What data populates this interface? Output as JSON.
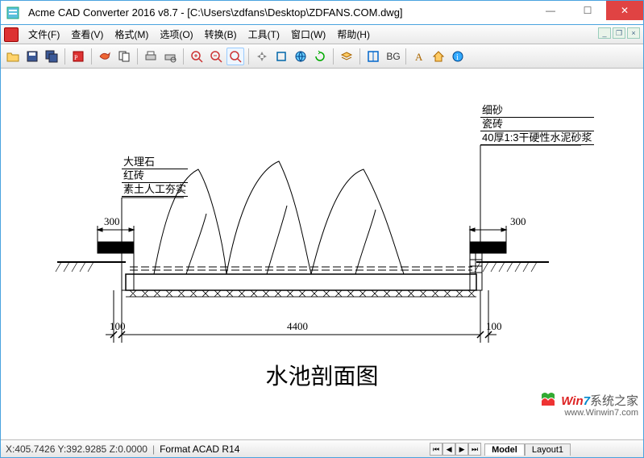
{
  "window": {
    "title": "Acme CAD Converter 2016 v8.7 - [C:\\Users\\zdfans\\Desktop\\ZDFANS.COM.dwg]"
  },
  "menus": {
    "file": "文件(F)",
    "view": "查看(V)",
    "format": "格式(M)",
    "options": "选项(O)",
    "convert": "转换(B)",
    "tools": "工具(T)",
    "window": "窗口(W)",
    "help": "帮助(H)"
  },
  "toolbar": {
    "bg_label": "BG"
  },
  "drawing": {
    "title": "水池剖面图",
    "left_labels": [
      "大理石",
      "红砖",
      "素土人工夯实"
    ],
    "right_labels": [
      "细砂",
      "瓷砖",
      "40厚1:3干硬性水泥砂浆"
    ],
    "dim_left_top": "300",
    "dim_right_top": "300",
    "dim_bottom_left": "100",
    "dim_bottom_center": "4400",
    "dim_bottom_right": "100"
  },
  "status": {
    "coords": "X:405.7426 Y:392.9285 Z:0.0000",
    "format": "Format ACAD R14"
  },
  "tabs": {
    "model": "Model",
    "layout1": "Layout1"
  },
  "watermark": {
    "brand_a": "Win",
    "brand_b": "7",
    "brand_c": "系统之家",
    "url": "www.Winwin7.com"
  }
}
